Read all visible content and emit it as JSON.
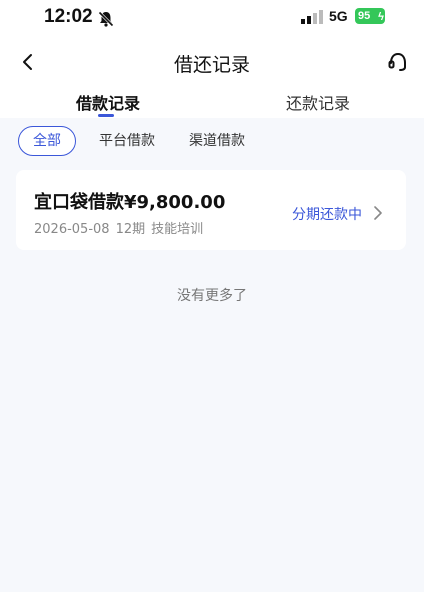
{
  "status_bar": {
    "time": "12:02",
    "network": "5G",
    "battery": "95"
  },
  "nav": {
    "title": "借还记录",
    "back_icon": "chevron-left-icon",
    "support_icon": "headset-icon"
  },
  "tabs": [
    {
      "label": "借款记录",
      "active": true
    },
    {
      "label": "还款记录",
      "active": false
    }
  ],
  "filters": [
    {
      "label": "全部",
      "active": true
    },
    {
      "label": "平台借款",
      "active": false
    },
    {
      "label": "渠道借款",
      "active": false
    }
  ],
  "records": [
    {
      "title": "宜口袋借款¥9,800.00",
      "date": "2026-05-08",
      "term": "12期",
      "purpose": "技能培训",
      "status": "分期还款中"
    }
  ],
  "footer_text": "没有更多了",
  "colors": {
    "accent": "#3b57d9",
    "battery": "#34c759",
    "background": "#f6f8fc"
  }
}
